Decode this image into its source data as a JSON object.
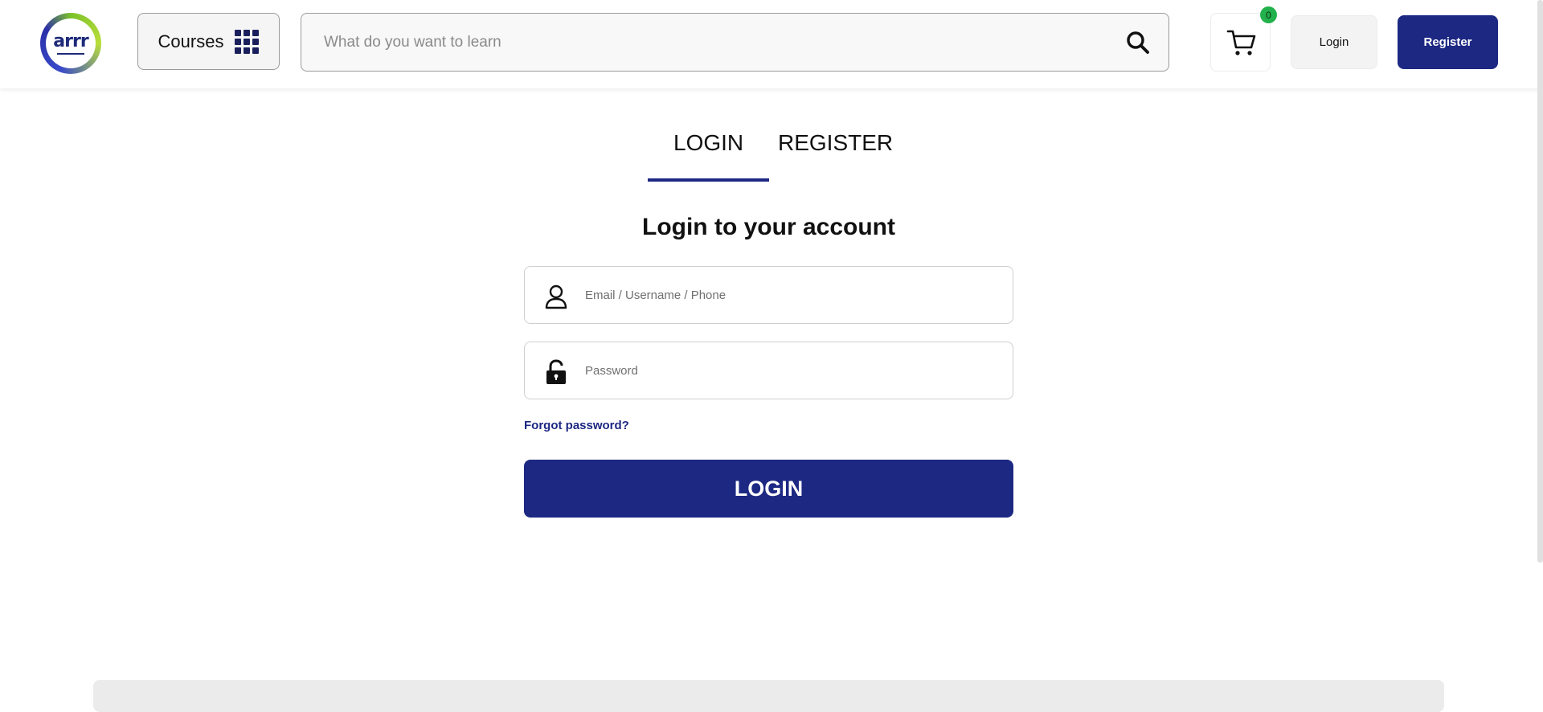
{
  "header": {
    "logo_text": "arrr",
    "courses_label": "Courses",
    "search_placeholder": "What do you want to learn",
    "cart_count": "0",
    "login_label": "Login",
    "register_label": "Register"
  },
  "tabs": {
    "login": "LOGIN",
    "register": "REGISTER",
    "active": "login"
  },
  "form": {
    "title": "Login to your account",
    "email_placeholder": "Email / Username / Phone",
    "password_placeholder": "Password",
    "forgot_label": "Forgot password?",
    "submit_label": "LOGIN"
  },
  "colors": {
    "brand": "#1c2882",
    "badge": "#22b14c"
  }
}
